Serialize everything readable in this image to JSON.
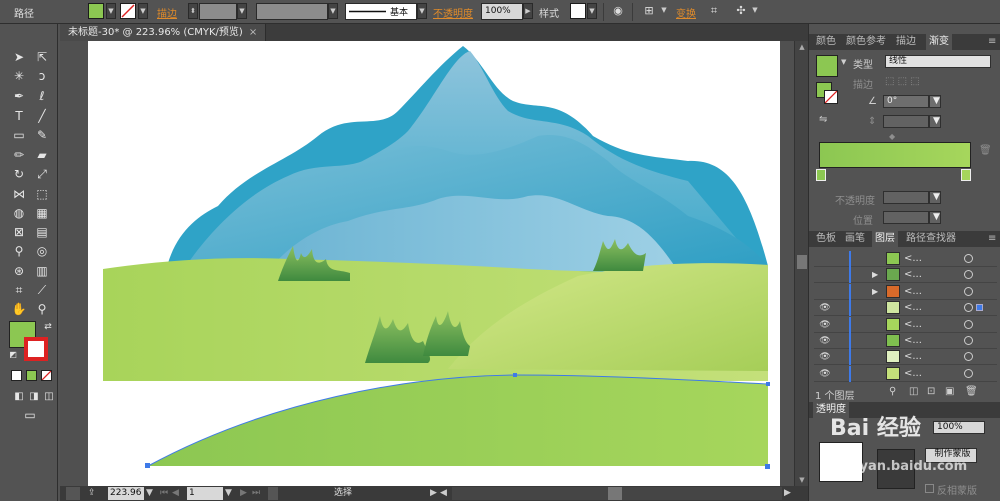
{
  "control_bar": {
    "selection_label": "路径",
    "stroke_label": "描边",
    "stroke_style": "基本",
    "opacity_label": "不透明度",
    "opacity_value": "100%",
    "style_label": "样式",
    "transform_label": "变换"
  },
  "document": {
    "tab_title": "未标题-30* @ 223.96% (CMYK/预览)",
    "close_glyph": "×"
  },
  "status_bar": {
    "zoom": "223.96",
    "page": "1",
    "tool_status": "选择"
  },
  "gradient_panel": {
    "tabs": [
      "颜色",
      "颜色参考",
      "描边",
      "渐变"
    ],
    "active_tab": "渐变",
    "type_label": "类型",
    "type_value": "线性",
    "stroke_label": "描边",
    "angle_value": "0°",
    "opacity_label": "不透明度",
    "location_label": "位置",
    "gradient_start": "#8cc752",
    "gradient_end": "#a6d65c"
  },
  "layers_panel": {
    "tabs": [
      "色板",
      "画笔",
      "图层",
      "路径查找器"
    ],
    "active_tab": "图层",
    "layer_name": "<...",
    "row_count": 8,
    "footer_label": "1 个图层"
  },
  "transparency_panel": {
    "title": "透明度",
    "opacity_value": "100%",
    "make_mask_button": "制作蒙版",
    "invert_mask_label": "反相蒙版"
  },
  "colors": {
    "ui_bg": "#535353",
    "accent_blue": "#3e7ae8",
    "fill_green": "#8cc752",
    "link_orange": "#e08b2a"
  }
}
